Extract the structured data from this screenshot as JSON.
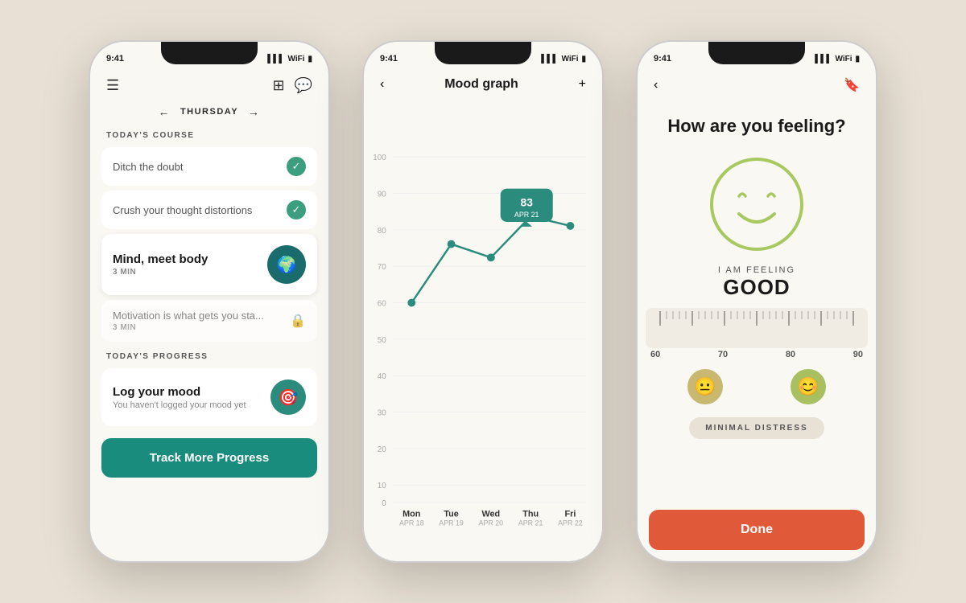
{
  "page": {
    "bg_color": "#e8e0d4"
  },
  "phone1": {
    "status_time": "9:41",
    "day_label": "THURSDAY",
    "section_course": "TODAY'S COURSE",
    "section_progress": "TODAY'S PROGRESS",
    "course_items": [
      {
        "title": "Ditch the doubt",
        "status": "done",
        "sub": ""
      },
      {
        "title": "Crush your thought distortions",
        "status": "done",
        "sub": ""
      },
      {
        "title": "Mind, meet body",
        "status": "active",
        "sub": "3 MIN"
      },
      {
        "title": "Motivation is what gets you sta...",
        "status": "locked",
        "sub": "3 MIN"
      }
    ],
    "progress_title": "Log your mood",
    "progress_sub": "You haven't logged your mood yet",
    "track_btn": "Track More Progress"
  },
  "phone2": {
    "status_time": "9:41",
    "title": "Mood graph",
    "chart": {
      "y_labels": [
        "100",
        "90",
        "80",
        "70",
        "60",
        "50",
        "40",
        "30",
        "20",
        "10",
        "0"
      ],
      "x_labels": [
        {
          "day": "Mon",
          "date": "APR 18"
        },
        {
          "day": "Tue",
          "date": "APR 19"
        },
        {
          "day": "Wed",
          "date": "APR 20"
        },
        {
          "day": "Thu",
          "date": "APR 21"
        },
        {
          "day": "Fri",
          "date": "APR 22"
        }
      ],
      "points": [
        {
          "x": 0,
          "y": 59
        },
        {
          "x": 1,
          "y": 75
        },
        {
          "x": 2,
          "y": 71
        },
        {
          "x": 3,
          "y": 83
        },
        {
          "x": 4,
          "y": 80
        }
      ],
      "tooltip_value": "83",
      "tooltip_label": "APR 21",
      "tooltip_point_index": 3
    }
  },
  "phone3": {
    "status_time": "9:41",
    "question": "How are you feeling?",
    "feeling_label": "I AM FEELING",
    "feeling_value": "GOOD",
    "ruler_labels": [
      "60",
      "70",
      "80",
      "90"
    ],
    "distress_label": "MINIMAL DISTRESS",
    "done_btn": "Done"
  }
}
